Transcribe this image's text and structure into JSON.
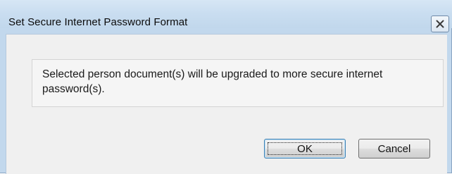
{
  "window": {
    "title": "Set Secure Internet Password Format",
    "close_icon": "close-icon"
  },
  "message": {
    "text": "Selected person document(s) will be upgraded to more secure internet password(s)."
  },
  "buttons": {
    "ok_label": "OK",
    "cancel_label": "Cancel"
  },
  "colors": {
    "title_bar": "#c9ddf0",
    "dialog_body": "#f0f0f0",
    "default_button_border": "#3c7fb1"
  }
}
